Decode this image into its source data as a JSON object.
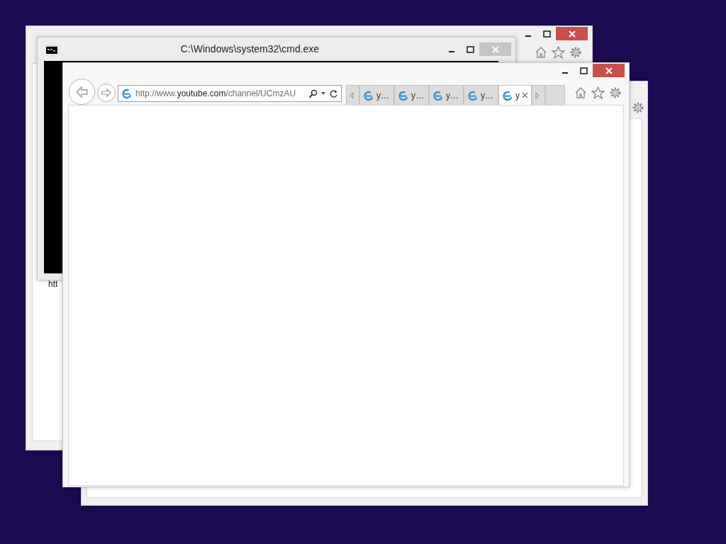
{
  "back_browser_window": {
    "page_text": "htt"
  },
  "console_window": {
    "title": "C:\\Windows\\system32\\cmd.exe"
  },
  "browser_window": {
    "address": "http://www.**youtube.com**/channel/UCmzAU",
    "tabs": [
      {
        "label": "y…",
        "selected": false
      },
      {
        "label": "y…",
        "selected": false
      },
      {
        "label": "y…",
        "selected": false
      },
      {
        "label": "y…",
        "selected": false
      },
      {
        "label": "y",
        "selected": true
      }
    ]
  }
}
